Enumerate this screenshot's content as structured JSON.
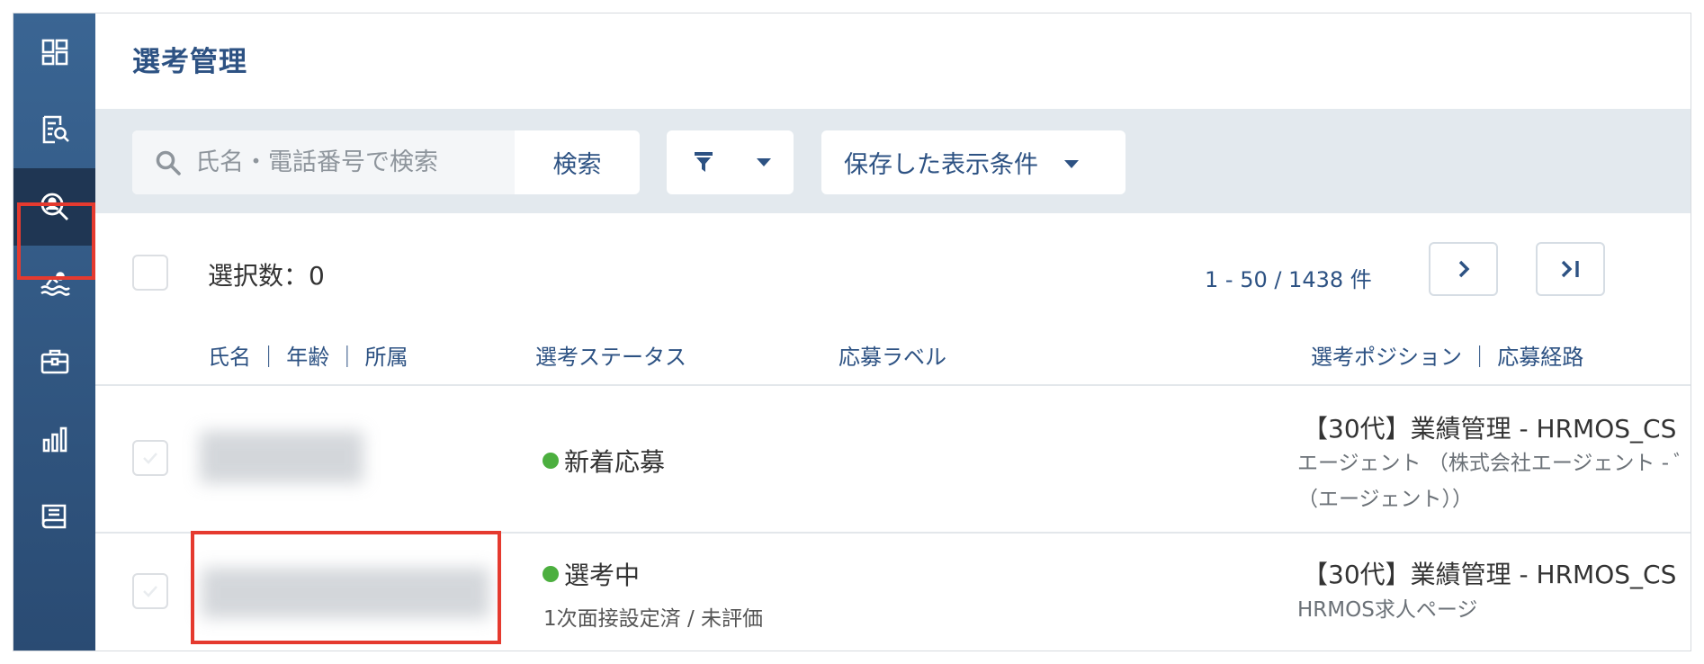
{
  "page": {
    "title": "選考管理"
  },
  "sidebar": {
    "items": [
      {
        "icon": "dashboard-icon"
      },
      {
        "icon": "document-search-icon"
      },
      {
        "icon": "candidate-search-icon",
        "active": true
      },
      {
        "icon": "swimmer-icon"
      },
      {
        "icon": "briefcase-icon"
      },
      {
        "icon": "bar-chart-icon"
      },
      {
        "icon": "report-icon"
      }
    ],
    "active_bg": "#1f3653"
  },
  "toolbar": {
    "search_placeholder": "氏名・電話番号で検索",
    "search_value": "",
    "search_button": "検索",
    "saved_conditions_label": "保存した表示条件"
  },
  "list": {
    "selected_count_label": "選択数：0",
    "pagination_text": "1 - 50 / 1438 件",
    "columns": {
      "name": "氏名 ｜ 年齢 ｜ 所属",
      "status": "選考ステータス",
      "label": "応募ラベル",
      "position": "選考ポジション ｜ 応募経路"
    },
    "rows": [
      {
        "status": "新着応募",
        "status_color": "#4caf3f",
        "sub_status": "",
        "position_title": "【30代】業績管理 - HRMOS_CS",
        "route_line1": "エージェント （株式会社エージェント - ﾞ",
        "route_line2": "（エージェント））"
      },
      {
        "status": "選考中",
        "status_color": "#4caf3f",
        "sub_status": "1次面接設定済 / 未評価",
        "position_title": "【30代】業績管理 - HRMOS_CS",
        "route_line1": "HRMOS求人ページ",
        "route_line2": ""
      }
    ]
  },
  "colors": {
    "accent": "#2d5283",
    "highlight": "#e53a2f",
    "toolbar_bg": "#e3e9ee"
  }
}
